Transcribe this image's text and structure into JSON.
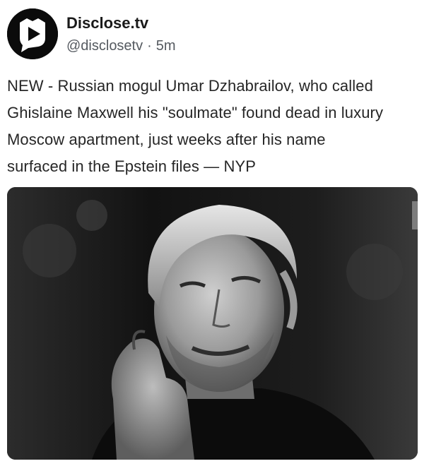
{
  "post": {
    "author": {
      "display_name": "Disclose.tv",
      "handle": "@disclosetv",
      "avatar_icon": "play-icon"
    },
    "separator": "·",
    "timestamp": "5m",
    "text": "NEW - Russian mogul Umar Dzhabrailov, who called\nGhislaine Maxwell his \"soulmate\" found dead in luxury\nMoscow apartment, just weeks after his name\nsurfaced in the Epstein files — NYP",
    "media": {
      "type": "photo",
      "style": "black-and-white portrait"
    }
  },
  "colors": {
    "text": "#262626",
    "secondary_text": "#555a60",
    "avatar_bg": "#0b0b0b"
  }
}
